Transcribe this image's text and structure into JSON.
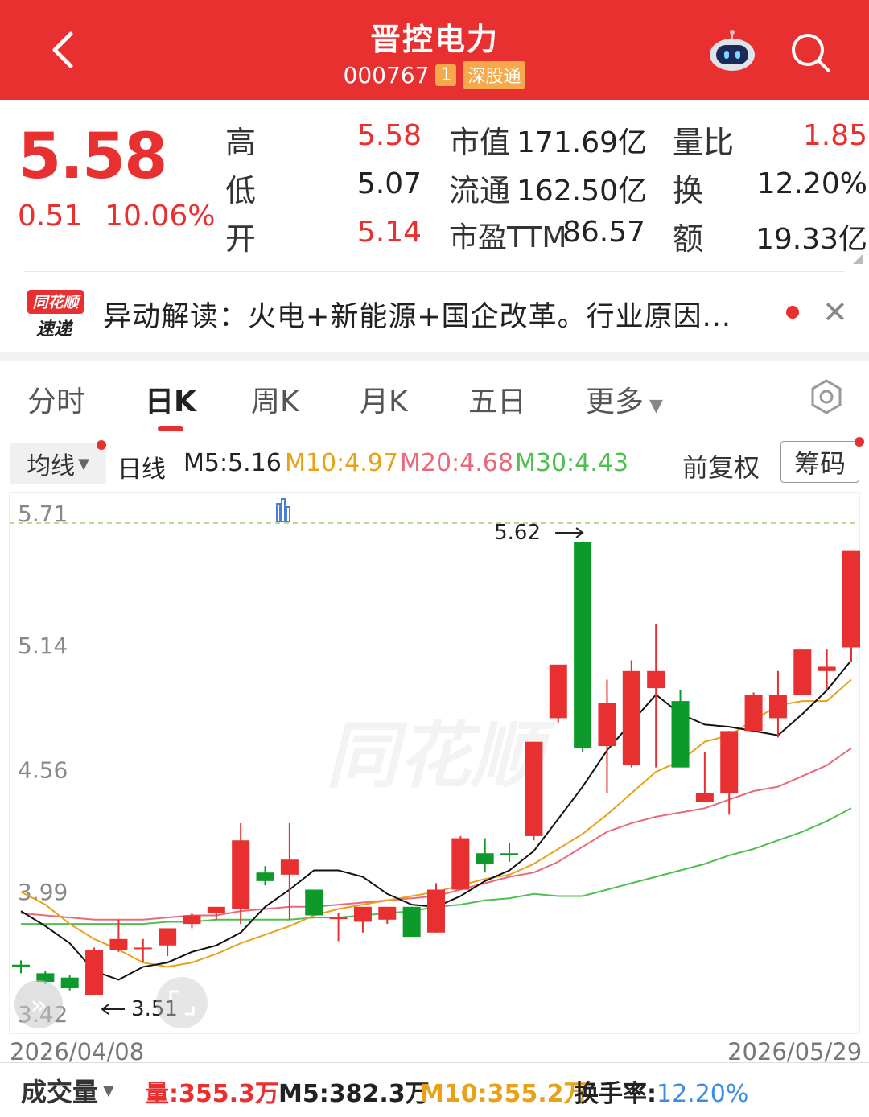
{
  "header": {
    "title": "晋控电力",
    "code": "000767",
    "badge_num": "1",
    "badge_connect": "深股通"
  },
  "quote": {
    "price": "5.58",
    "change": "0.51",
    "change_pct": "10.06%",
    "high_label": "高",
    "high": "5.58",
    "low_label": "低",
    "low": "5.07",
    "open_label": "开",
    "open": "5.14",
    "mcap_label": "市值",
    "mcap": "171.69亿",
    "float_label": "流通",
    "float": "162.50亿",
    "pe_label": "市盈TTM",
    "pe": "86.57",
    "vr_label": "量比",
    "vr": "1.85",
    "turn_label": "换",
    "turn": "12.20%",
    "amt_label": "额",
    "amt": "19.33亿"
  },
  "news": {
    "logo_top": "同花顺",
    "logo_bottom": "速递",
    "text": "异动解读：火电+新能源+国企改革。行业原因..."
  },
  "tabs": [
    "分时",
    "日K",
    "周K",
    "月K",
    "五日",
    "更多"
  ],
  "active_tab": "日K",
  "ma": {
    "selector": "均线",
    "period": "日线",
    "m5": "M5:5.16",
    "m10": "M10:4.97",
    "m20": "M20:4.68",
    "m30": "M30:4.43",
    "adjust": "前复权",
    "chip": "筹码"
  },
  "colors": {
    "up": "#e93030",
    "down": "#0d9a2a",
    "m5": "#111111",
    "m10": "#e8a21a",
    "m20": "#e86a7a",
    "m30": "#4fbf4f"
  },
  "chart_data": {
    "type": "candlestick",
    "y_ticks": [
      "5.71",
      "5.14",
      "4.56",
      "3.99",
      "3.42"
    ],
    "ylim": [
      3.42,
      5.71
    ],
    "max_label": "5.62",
    "min_label": "3.51",
    "watermark": "同花顺",
    "candles": [
      {
        "o": 3.65,
        "c": 3.64,
        "h": 3.67,
        "l": 3.61
      },
      {
        "o": 3.61,
        "c": 3.57,
        "h": 3.62,
        "l": 3.56
      },
      {
        "o": 3.59,
        "c": 3.54,
        "h": 3.6,
        "l": 3.53
      },
      {
        "o": 3.51,
        "c": 3.72,
        "h": 3.73,
        "l": 3.51
      },
      {
        "o": 3.72,
        "c": 3.77,
        "h": 3.86,
        "l": 3.71
      },
      {
        "o": 3.73,
        "c": 3.73,
        "h": 3.77,
        "l": 3.66
      },
      {
        "o": 3.74,
        "c": 3.82,
        "h": 3.82,
        "l": 3.69
      },
      {
        "o": 3.84,
        "c": 3.88,
        "h": 3.89,
        "l": 3.82
      },
      {
        "o": 3.89,
        "c": 3.92,
        "h": 3.92,
        "l": 3.86
      },
      {
        "o": 3.91,
        "c": 4.23,
        "h": 4.31,
        "l": 3.84
      },
      {
        "o": 4.08,
        "c": 4.04,
        "h": 4.11,
        "l": 4.02
      },
      {
        "o": 4.07,
        "c": 4.14,
        "h": 4.31,
        "l": 3.86
      },
      {
        "o": 4.0,
        "c": 3.88,
        "h": 4.0,
        "l": 3.88
      },
      {
        "o": 3.87,
        "c": 3.87,
        "h": 3.89,
        "l": 3.76
      },
      {
        "o": 3.85,
        "c": 3.92,
        "h": 3.92,
        "l": 3.8
      },
      {
        "o": 3.86,
        "c": 3.92,
        "h": 3.92,
        "l": 3.84
      },
      {
        "o": 3.92,
        "c": 3.78,
        "h": 3.92,
        "l": 3.78
      },
      {
        "o": 3.8,
        "c": 4.0,
        "h": 4.03,
        "l": 3.8
      },
      {
        "o": 4.0,
        "c": 4.24,
        "h": 4.25,
        "l": 4.0
      },
      {
        "o": 4.17,
        "c": 4.12,
        "h": 4.24,
        "l": 4.08
      },
      {
        "o": 4.17,
        "c": 4.16,
        "h": 4.22,
        "l": 4.13
      },
      {
        "o": 4.25,
        "c": 4.69,
        "h": 4.69,
        "l": 4.23
      },
      {
        "o": 4.8,
        "c": 5.05,
        "h": 5.05,
        "l": 4.78
      },
      {
        "o": 5.62,
        "c": 4.66,
        "h": 5.62,
        "l": 4.64
      },
      {
        "o": 4.67,
        "c": 4.87,
        "h": 4.98,
        "l": 4.45
      },
      {
        "o": 4.58,
        "c": 5.02,
        "h": 5.07,
        "l": 4.57
      },
      {
        "o": 4.94,
        "c": 5.02,
        "h": 5.24,
        "l": 4.57
      },
      {
        "o": 4.88,
        "c": 4.57,
        "h": 4.93,
        "l": 4.57
      },
      {
        "o": 4.41,
        "c": 4.45,
        "h": 4.64,
        "l": 4.41
      },
      {
        "o": 4.45,
        "c": 4.74,
        "h": 4.74,
        "l": 4.35
      },
      {
        "o": 4.74,
        "c": 4.91,
        "h": 4.92,
        "l": 4.79
      },
      {
        "o": 4.8,
        "c": 4.91,
        "h": 5.02,
        "l": 4.71
      },
      {
        "o": 4.91,
        "c": 5.12,
        "h": 5.12,
        "l": 4.91
      },
      {
        "o": 5.02,
        "c": 5.04,
        "h": 5.12,
        "l": 4.93
      },
      {
        "o": 5.13,
        "c": 5.58,
        "h": 5.58,
        "l": 5.06
      }
    ],
    "m5": [
      3.9,
      3.83,
      3.75,
      3.62,
      3.58,
      3.64,
      3.66,
      3.71,
      3.74,
      3.8,
      3.92,
      4.0,
      4.09,
      4.09,
      4.06,
      3.98,
      3.93,
      3.92,
      3.97,
      4.04,
      4.09,
      4.18,
      4.33,
      4.48,
      4.65,
      4.78,
      4.91,
      4.82,
      4.77,
      4.76,
      4.74,
      4.72,
      4.82,
      4.93,
      5.07
    ],
    "m10": [
      3.99,
      3.93,
      3.84,
      3.77,
      3.72,
      3.66,
      3.64,
      3.66,
      3.7,
      3.75,
      3.79,
      3.83,
      3.88,
      3.91,
      3.93,
      3.95,
      3.97,
      3.99,
      4.02,
      4.05,
      4.07,
      4.12,
      4.19,
      4.26,
      4.35,
      4.45,
      4.55,
      4.6,
      4.69,
      4.72,
      4.79,
      4.86,
      4.88,
      4.88,
      4.98
    ],
    "m20": [
      3.89,
      3.88,
      3.87,
      3.86,
      3.86,
      3.86,
      3.87,
      3.88,
      3.88,
      3.9,
      3.91,
      3.92,
      3.92,
      3.93,
      3.94,
      3.95,
      3.96,
      3.97,
      4.0,
      4.03,
      4.06,
      4.08,
      4.13,
      4.2,
      4.27,
      4.31,
      4.34,
      4.36,
      4.38,
      4.42,
      4.46,
      4.48,
      4.53,
      4.58,
      4.66
    ],
    "m30": [
      3.84,
      3.84,
      3.84,
      3.84,
      3.84,
      3.84,
      3.85,
      3.85,
      3.86,
      3.86,
      3.86,
      3.86,
      3.87,
      3.87,
      3.88,
      3.89,
      3.9,
      3.92,
      3.93,
      3.95,
      3.96,
      3.98,
      3.97,
      3.97,
      4.0,
      4.03,
      4.06,
      4.09,
      4.12,
      4.16,
      4.19,
      4.23,
      4.27,
      4.32,
      4.38
    ]
  },
  "dates": {
    "start": "2026/04/08",
    "end": "2026/05/29"
  },
  "volume": {
    "selector": "成交量",
    "vol": "量:355.3万",
    "m5": "M5:382.3万",
    "m10": "M10:355.2万",
    "turnover_label": "换手率:",
    "turnover": "12.20%"
  }
}
